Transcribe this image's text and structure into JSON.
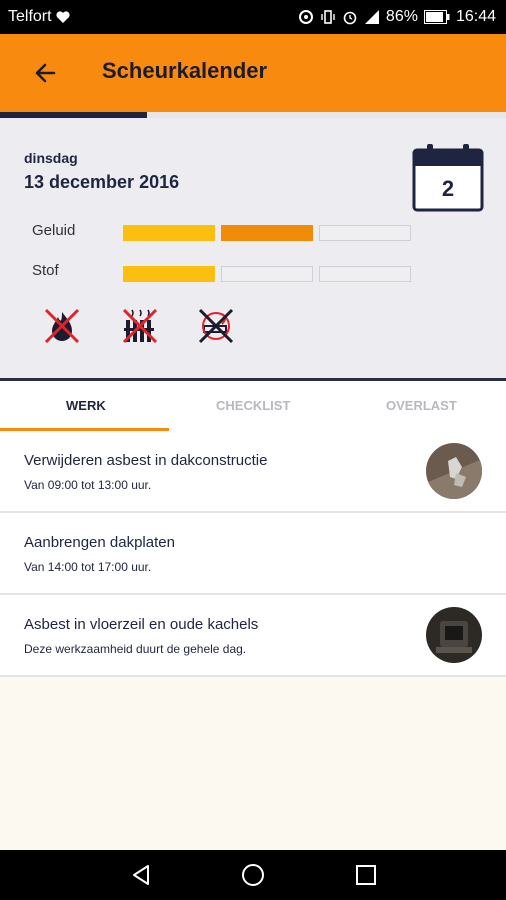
{
  "status": {
    "carrier": "Telfort",
    "battery": "86%",
    "time": "16:44"
  },
  "appbar": {
    "title": "Scheurkalender"
  },
  "progress": {
    "fraction": 0.29
  },
  "day": {
    "weekday": "dinsdag",
    "date": "13 december 2016",
    "calendar_number": "2"
  },
  "levels": [
    {
      "label": "Geluid",
      "level": 2,
      "max": 3
    },
    {
      "label": "Stof",
      "level": 1,
      "max": 3
    }
  ],
  "hazards": [
    "no-fire-icon",
    "no-heater-icon",
    "no-smoking-icon"
  ],
  "tabs": [
    {
      "label": "WERK",
      "active": true
    },
    {
      "label": "CHECKLIST",
      "active": false
    },
    {
      "label": "OVERLAST",
      "active": false
    }
  ],
  "items": [
    {
      "title": "Verwijderen asbest in dakconstructie",
      "subtitle": "Van 09:00 tot 13:00 uur.",
      "has_image": true
    },
    {
      "title": "Aanbrengen dakplaten",
      "subtitle": "Van 14:00 tot 17:00 uur.",
      "has_image": false
    },
    {
      "title": "Asbest in vloerzeil en oude kachels",
      "subtitle": "Deze werkzaamheid duurt de gehele dag.",
      "has_image": true
    }
  ],
  "colors": {
    "accent": "#f98a10",
    "navy": "#1f2540",
    "level_yellow": "#fbbf10",
    "level_orange": "#f08c0a"
  }
}
